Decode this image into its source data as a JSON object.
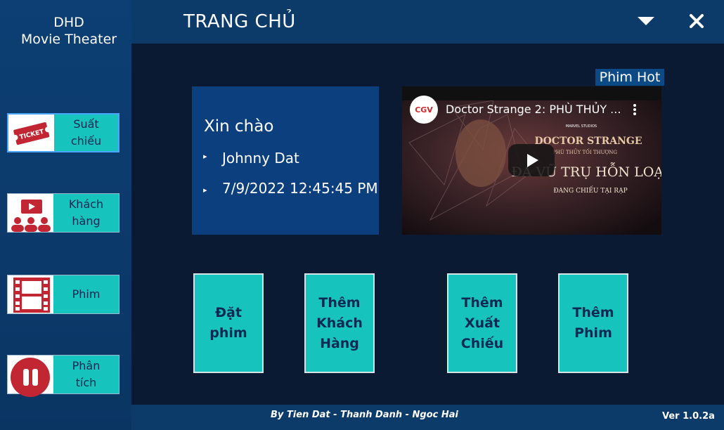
{
  "brand": {
    "line1": "DHD",
    "line2": "Movie Theater"
  },
  "header": {
    "title": "TRANG CHỦ"
  },
  "sidebar": {
    "items": [
      {
        "label_line1": "Suất",
        "label_line2": "chiếu",
        "icon": "ticket-icon",
        "ticket_text": "TICKET",
        "active": true
      },
      {
        "label_line1": "Khách",
        "label_line2": "hàng",
        "icon": "customers-icon",
        "active": false
      },
      {
        "label_line1": "Phim",
        "label_line2": "",
        "icon": "film-strip-icon",
        "active": false
      },
      {
        "label_line1": "Phân",
        "label_line2": "tích",
        "icon": "pause-icon",
        "active": false
      }
    ]
  },
  "greeting": {
    "title": "Xin chào",
    "user": "Johnny Dat",
    "datetime": "7/9/2022 12:45:45 PM"
  },
  "hot": {
    "label": "Phim Hot",
    "video_title": "Doctor Strange 2: PHÙ THỦY ...",
    "channel_logo": "CGV",
    "poster_brand": "MARVEL STUDIOS",
    "poster_title": "DOCTOR STRANGE",
    "poster_subtitle": "PHÙ THỦY TỐI THƯỢNG",
    "poster_tagline": "ĐA VŨ TRỤ HỖN LOẠN",
    "poster_release": "ĐANG CHIẾU TẠI RẠP"
  },
  "actions": [
    {
      "line1": "Đặt",
      "line2": "phim",
      "line3": ""
    },
    {
      "line1": "Thêm",
      "line2": "Khách",
      "line3": "Hàng"
    },
    {
      "line1": "Thêm",
      "line2": "Xuất",
      "line3": "Chiếu"
    },
    {
      "line1": "Thêm",
      "line2": "Phim",
      "line3": ""
    }
  ],
  "footer": {
    "credits": "By Tien Dat - Thanh Danh - Ngoc Hai",
    "version": "Ver 1.0.2a"
  },
  "colors": {
    "sidebar": "#0d3f74",
    "panel": "#0a1a32",
    "accent": "#17c3bd",
    "card": "#0c3f7e",
    "icon_red": "#b6202e"
  }
}
